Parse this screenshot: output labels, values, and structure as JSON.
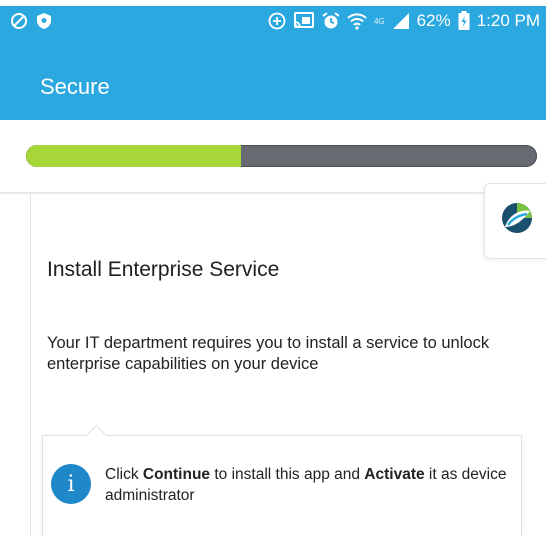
{
  "status_bar": {
    "battery": "62%",
    "time": "1:20 PM",
    "network": "4G",
    "icons": [
      "blocked-icon",
      "shield-icon",
      "add-circle-icon",
      "cast-icon",
      "alarm-icon",
      "wifi-icon",
      "signal-icon",
      "battery-icon"
    ]
  },
  "app_bar": {
    "title": "Secure"
  },
  "progress": {
    "value": 0.42
  },
  "content": {
    "heading": "Install Enterprise Service",
    "description": "Your IT department requires you to install a service to unlock enterprise capabilities on your device",
    "notice": {
      "icon": "info-icon",
      "icon_glyph": "i",
      "part1": "Click ",
      "continue_word": "Continue",
      "part2": " to install this app and ",
      "activate_word": "Activate",
      "part3": " it as device administrator"
    }
  },
  "colors": {
    "primary": "#2ba8df",
    "progress_fill": "#a6d637",
    "progress_track": "#676a70",
    "info": "#1e88c9"
  }
}
